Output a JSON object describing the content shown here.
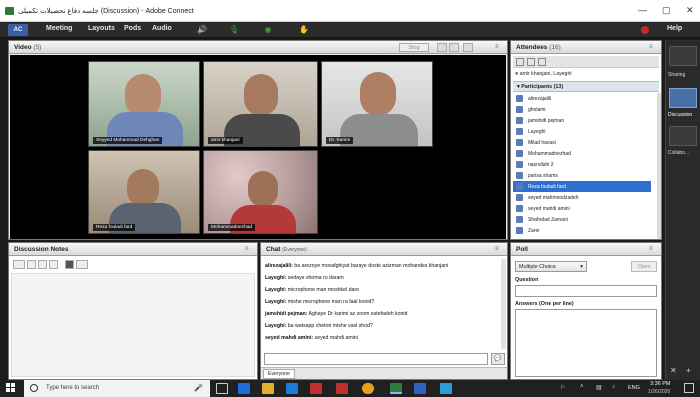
{
  "window": {
    "title": "جلسه دفاع تحصیلات تکمیلی (Discussion) - Adobe Connect",
    "min_glyph": "—",
    "max_glyph": "▢",
    "close_glyph": "✕"
  },
  "menubar": {
    "logo_text": "AC",
    "items": [
      "Meeting",
      "Layouts",
      "Pods",
      "Audio"
    ],
    "help": "Help"
  },
  "video": {
    "title": "Video",
    "count": "(5)",
    "stop_label": "Stop",
    "tiles": [
      {
        "label": "Seyyed Mohammad Dehghan"
      },
      {
        "label": "amir khanjani"
      },
      {
        "label": "Dr. Karimi"
      },
      {
        "label": "Reza fouladi fard"
      },
      {
        "label": "Mohammadnezhad"
      }
    ]
  },
  "attendees": {
    "title": "Attendees",
    "count": "(16)",
    "host_line": "amir khanjani, Layeghi",
    "participants_label": "Participants (13)",
    "participants": [
      "alirezajalili",
      "gholami",
      "jamshidi pejman",
      "Layeghi",
      "Milad havasi",
      "Mohammadnezhad",
      "nasrollahi 2",
      "parisa shams",
      "Reza fouladi fard",
      "seyed mahmoodzadeh",
      "seyed mahdi amini",
      "Shahrdad Zamani",
      "Zarei"
    ],
    "selected_index": 8
  },
  "notes": {
    "title": "Discussion Notes"
  },
  "chat": {
    "title": "Chat",
    "scope": "(Everyone)",
    "messages": [
      {
        "author": "alirezajalili:",
        "text": " ba arezoye movafghiyat baraye doste azizman mohandes khanjani"
      },
      {
        "author": "Layeghi:",
        "text": " sedaye shoma ro daram"
      },
      {
        "author": "Layeghi:",
        "text": " microphone man moshkel dare"
      },
      {
        "author": "Layeghi:",
        "text": " mishe microphone man ra faal konid?"
      },
      {
        "author": "jamshidi pejman:",
        "text": " Aghaye Dr karimi az zoom estefadeh konid"
      },
      {
        "author": "Layeghi:",
        "text": " ba watsapp chetori mishe vasl shod?"
      },
      {
        "author": "seyed mahdi amini:",
        "text": " seyed mahdi amini"
      }
    ],
    "tab_label": "Everyone"
  },
  "poll": {
    "title": "Poll",
    "dropdown_value": "Multiple Choice",
    "open_label": "Open",
    "question_label": "Question",
    "answers_label": "Answers (One per line)"
  },
  "right_strip": {
    "items": [
      "Sharing",
      "Discussion",
      "Collabo..."
    ]
  },
  "taskbar": {
    "search_placeholder": "Type here to search",
    "lang": "ENG",
    "time": "3:36 PM",
    "date": "1/26/2020"
  },
  "colors": {
    "selected_row": "#2f6fd0",
    "green_ico": "#3aa83a",
    "red_badge": "#c7282c"
  }
}
